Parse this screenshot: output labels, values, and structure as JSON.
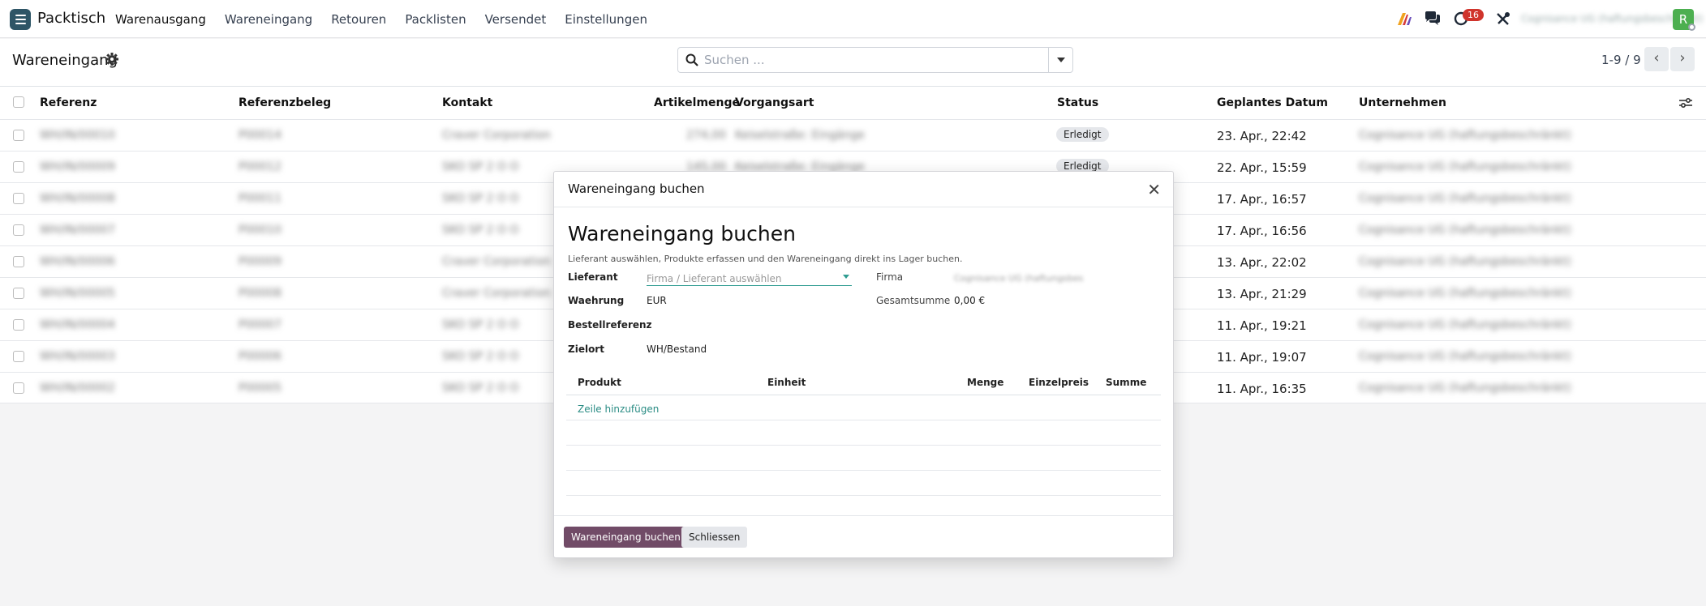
{
  "navbar": {
    "app_name": "Packtisch",
    "menu": [
      {
        "label": "Warenausgang"
      },
      {
        "label": "Wareneingang"
      },
      {
        "label": "Retouren"
      },
      {
        "label": "Packlisten"
      },
      {
        "label": "Versendet"
      },
      {
        "label": "Einstellungen"
      }
    ],
    "activity_count": "16",
    "user_company": "Cognisance UG (haftungsbeschränkt)",
    "avatar_letter": "R"
  },
  "control": {
    "title": "Wareneingang",
    "search_placeholder": "Suchen ...",
    "pager": "1-9 / 9"
  },
  "list": {
    "columns": [
      "Referenz",
      "Referenzbeleg",
      "Kontakt",
      "Artikelmenge",
      "Vorgangsart",
      "Status",
      "Geplantes Datum",
      "Unternehmen"
    ],
    "rows": [
      {
        "ref": "WH/IN/00010",
        "doc": "P00014",
        "contact": "Craver Corporation",
        "qty": "274,00",
        "type": "Keiselstraße: Eingänge",
        "status": "Erledigt",
        "date": "23. Apr., 22:42",
        "company": "Cognisance UG (haftungsbeschränkt)"
      },
      {
        "ref": "WH/IN/00009",
        "doc": "P00012",
        "contact": "SKO SP 2 O O",
        "qty": "145,00",
        "type": "Keiselstraße: Eingänge",
        "status": "Erledigt",
        "date": "22. Apr., 15:59",
        "company": "Cognisance UG (haftungsbeschränkt)"
      },
      {
        "ref": "WH/IN/00008",
        "doc": "P00011",
        "contact": "SKO SP 2 O O",
        "qty": "",
        "type": "",
        "status": "",
        "date": "17. Apr., 16:57",
        "company": "Cognisance UG (haftungsbeschränkt)"
      },
      {
        "ref": "WH/IN/00007",
        "doc": "P00010",
        "contact": "SKO SP 2 O O",
        "qty": "",
        "type": "",
        "status": "",
        "date": "17. Apr., 16:56",
        "company": "Cognisance UG (haftungsbeschränkt)"
      },
      {
        "ref": "WH/IN/00006",
        "doc": "P00009",
        "contact": "Craver Corporation",
        "qty": "",
        "type": "",
        "status": "",
        "date": "13. Apr., 22:02",
        "company": "Cognisance UG (haftungsbeschränkt)"
      },
      {
        "ref": "WH/IN/00005",
        "doc": "P00008",
        "contact": "Craver Corporation",
        "qty": "",
        "type": "",
        "status": "",
        "date": "13. Apr., 21:29",
        "company": "Cognisance UG (haftungsbeschränkt)"
      },
      {
        "ref": "WH/IN/00004",
        "doc": "P00007",
        "contact": "SKO SP 2 O O",
        "qty": "",
        "type": "",
        "status": "",
        "date": "11. Apr., 19:21",
        "company": "Cognisance UG (haftungsbeschränkt)"
      },
      {
        "ref": "WH/IN/00003",
        "doc": "P00006",
        "contact": "SKO SP 2 O O",
        "qty": "",
        "type": "",
        "status": "",
        "date": "11. Apr., 19:07",
        "company": "Cognisance UG (haftungsbeschränkt)"
      },
      {
        "ref": "WH/IN/00002",
        "doc": "P00005",
        "contact": "SKO SP 2 O O",
        "qty": "",
        "type": "",
        "status": "",
        "date": "11. Apr., 16:35",
        "company": "Cognisance UG (haftungsbeschränkt)"
      }
    ]
  },
  "dialog": {
    "header_title": "Wareneingang buchen",
    "title": "Wareneingang buchen",
    "description": "Lieferant auswählen, Produkte erfassen und den Wareneingang direkt ins Lager buchen.",
    "supplier_label": "Lieferant",
    "supplier_placeholder": "Firma / Lieferant auswählen",
    "firma_label": "Firma",
    "firma_value": "Cognisance UG (haftungsbes",
    "currency_label": "Waehrung",
    "currency_value": "EUR",
    "total_label": "Gesamtsumme",
    "total_value": "0,00 €",
    "order_ref_label": "Bestellreferenz",
    "destination_label": "Zielort",
    "destination_value": "WH/Bestand",
    "table_headers": [
      "Produkt",
      "Einheit",
      "Menge",
      "Einzelpreis",
      "Summe"
    ],
    "add_line": "Zeile hinzufügen",
    "confirm_button": "Wareneingang buchen",
    "close_button": "Schliessen"
  }
}
